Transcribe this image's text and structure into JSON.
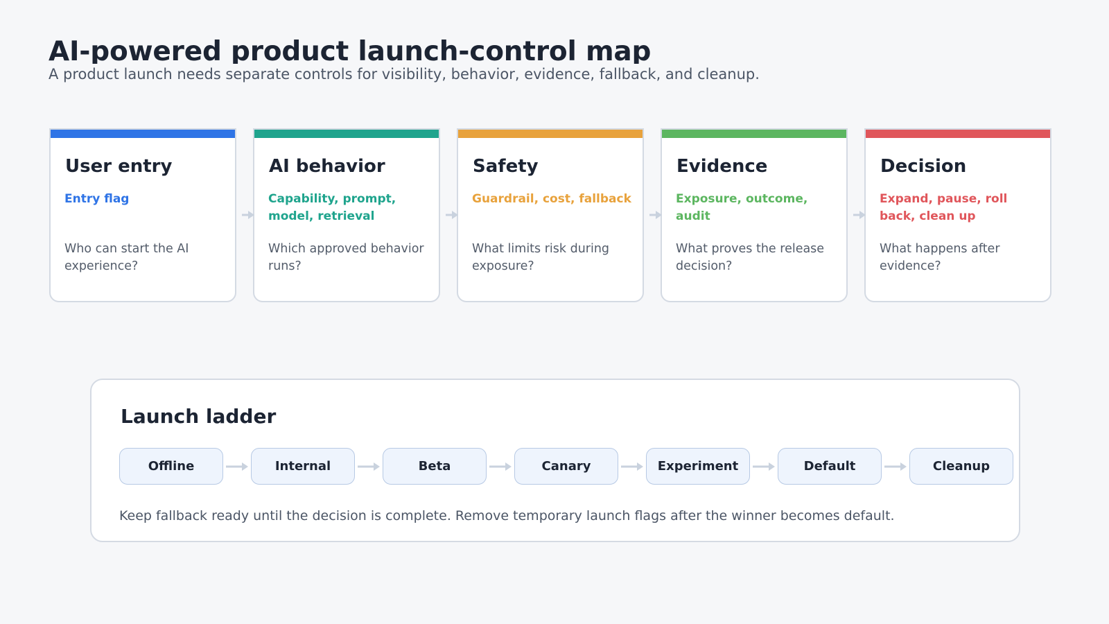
{
  "header": {
    "title": "AI-powered product launch-control map",
    "subtitle": "A product launch needs separate controls for visibility, behavior, evidence, fallback, and cleanup."
  },
  "stages": [
    {
      "name": "User entry",
      "controls": "Entry flag",
      "question": "Who can start the AI experience?",
      "color": "#2f74e6"
    },
    {
      "name": "AI behavior",
      "controls": "Capability, prompt, model, retrieval",
      "question": "Which approved behavior runs?",
      "color": "#1fa48d"
    },
    {
      "name": "Safety",
      "controls": "Guardrail, cost, fallback",
      "question": "What limits risk during exposure?",
      "color": "#e8a23c"
    },
    {
      "name": "Evidence",
      "controls": "Exposure, outcome, audit",
      "question": "What proves the release decision?",
      "color": "#5cb660"
    },
    {
      "name": "Decision",
      "controls": "Expand, pause, roll back, clean up",
      "question": "What happens after evidence?",
      "color": "#e0565b"
    }
  ],
  "ladder": {
    "title": "Launch ladder",
    "steps": [
      "Offline",
      "Internal",
      "Beta",
      "Canary",
      "Experiment",
      "Default",
      "Cleanup"
    ],
    "note": "Keep fallback ready until the decision is complete. Remove temporary launch flags after the winner becomes default."
  },
  "colors": {
    "arrow": "#c9d2de",
    "card_border": "#d4dae3",
    "step_fill": "#eef4fd",
    "step_border": "#b7c9e4"
  }
}
